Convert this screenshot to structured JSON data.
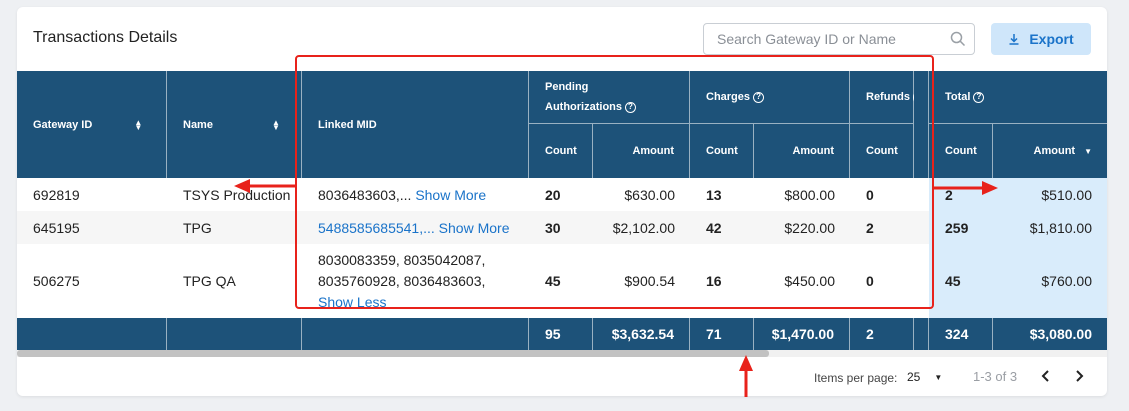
{
  "card": {
    "title": "Transactions Details"
  },
  "search": {
    "placeholder": "Search Gateway ID or Name"
  },
  "export": {
    "label": "Export"
  },
  "headers": {
    "gateway_id": "Gateway ID",
    "name": "Name",
    "linked_mid": "Linked MID",
    "pending_line1": "Pending",
    "pending_line2": "Authorizations",
    "charges": "Charges",
    "refunds": "Refunds",
    "total": "Total",
    "count": "Count",
    "amount": "Amount"
  },
  "rows": [
    {
      "gateway_id": "692819",
      "name": "TSYS Production",
      "mid": "8036483603,...",
      "mid_link": "Show More",
      "pend_count": "20",
      "pend_amount": "$630.00",
      "charges_count": "13",
      "charges_amount": "$800.00",
      "refunds_count": "0",
      "total_count": "2",
      "total_amount": "$510.00"
    },
    {
      "gateway_id": "645195",
      "name": "TPG",
      "mid": "5488585685541,...",
      "mid_link": "Show More",
      "pend_count": "30",
      "pend_amount": "$2,102.00",
      "charges_count": "42",
      "charges_amount": "$220.00",
      "refunds_count": "2",
      "total_count": "259",
      "total_amount": "$1,810.00"
    },
    {
      "gateway_id": "506275",
      "name": "TPG QA",
      "mid_lines": [
        "8030083359, 8035042087,",
        "8035760928, 8036483603,"
      ],
      "mid_link": "Show Less",
      "pend_count": "45",
      "pend_amount": "$900.54",
      "charges_count": "16",
      "charges_amount": "$450.00",
      "refunds_count": "0",
      "total_count": "45",
      "total_amount": "$760.00"
    }
  ],
  "totals": {
    "pend_count": "95",
    "pend_amount": "$3,632.54",
    "charges_count": "71",
    "charges_amount": "$1,470.00",
    "refunds_count": "2",
    "total_count": "324",
    "total_amount": "$3,080.00"
  },
  "pager": {
    "items_per_page_label": "Items per page:",
    "items_per_page": "25",
    "range": "1-3 of 3"
  },
  "colors": {
    "header_bg": "#1d5279",
    "accent": "#1a73c9",
    "highlight": "#d9ecfb",
    "annotation": "#e8221b"
  },
  "icons": [
    "search-icon",
    "download-icon",
    "sort-icon",
    "help-icon",
    "sort-desc-icon",
    "chevron-down-icon",
    "chevron-left-icon",
    "chevron-right-icon"
  ]
}
